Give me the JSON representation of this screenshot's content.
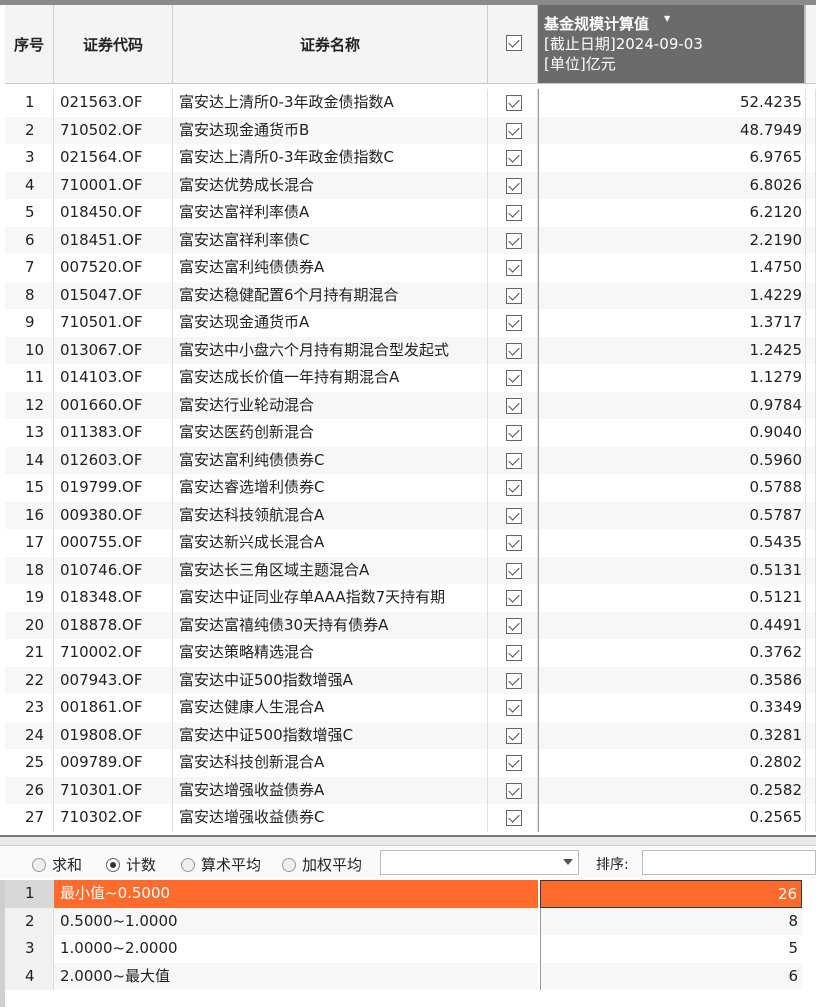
{
  "header": {
    "col_no": "序号",
    "col_code": "证券代码",
    "col_name": "证券名称",
    "metric_title": "基金规模计算值",
    "metric_date": "[截止日期]2024-09-03",
    "metric_unit": "[单位]亿元"
  },
  "rows": [
    {
      "no": "1",
      "code": "021563.OF",
      "name": "富安达上清所0-3年政金债指数A",
      "value": "52.4235"
    },
    {
      "no": "2",
      "code": "710502.OF",
      "name": "富安达现金通货币B",
      "value": "48.7949"
    },
    {
      "no": "3",
      "code": "021564.OF",
      "name": "富安达上清所0-3年政金债指数C",
      "value": "6.9765"
    },
    {
      "no": "4",
      "code": "710001.OF",
      "name": "富安达优势成长混合",
      "value": "6.8026"
    },
    {
      "no": "5",
      "code": "018450.OF",
      "name": "富安达富祥利率债A",
      "value": "6.2120"
    },
    {
      "no": "6",
      "code": "018451.OF",
      "name": "富安达富祥利率债C",
      "value": "2.2190"
    },
    {
      "no": "7",
      "code": "007520.OF",
      "name": "富安达富利纯债债券A",
      "value": "1.4750"
    },
    {
      "no": "8",
      "code": "015047.OF",
      "name": "富安达稳健配置6个月持有期混合",
      "value": "1.4229"
    },
    {
      "no": "9",
      "code": "710501.OF",
      "name": "富安达现金通货币A",
      "value": "1.3717"
    },
    {
      "no": "10",
      "code": "013067.OF",
      "name": "富安达中小盘六个月持有期混合型发起式",
      "value": "1.2425"
    },
    {
      "no": "11",
      "code": "014103.OF",
      "name": "富安达成长价值一年持有期混合A",
      "value": "1.1279"
    },
    {
      "no": "12",
      "code": "001660.OF",
      "name": "富安达行业轮动混合",
      "value": "0.9784"
    },
    {
      "no": "13",
      "code": "011383.OF",
      "name": "富安达医药创新混合",
      "value": "0.9040"
    },
    {
      "no": "14",
      "code": "012603.OF",
      "name": "富安达富利纯债债券C",
      "value": "0.5960"
    },
    {
      "no": "15",
      "code": "019799.OF",
      "name": "富安达睿选增利债券C",
      "value": "0.5788"
    },
    {
      "no": "16",
      "code": "009380.OF",
      "name": "富安达科技领航混合A",
      "value": "0.5787"
    },
    {
      "no": "17",
      "code": "000755.OF",
      "name": "富安达新兴成长混合A",
      "value": "0.5435"
    },
    {
      "no": "18",
      "code": "010746.OF",
      "name": "富安达长三角区域主题混合A",
      "value": "0.5131"
    },
    {
      "no": "19",
      "code": "018348.OF",
      "name": "富安达中证同业存单AAA指数7天持有期",
      "value": "0.5121"
    },
    {
      "no": "20",
      "code": "018878.OF",
      "name": "富安达富禧纯债30天持有债券A",
      "value": "0.4491"
    },
    {
      "no": "21",
      "code": "710002.OF",
      "name": "富安达策略精选混合",
      "value": "0.3762"
    },
    {
      "no": "22",
      "code": "007943.OF",
      "name": "富安达中证500指数增强A",
      "value": "0.3586"
    },
    {
      "no": "23",
      "code": "001861.OF",
      "name": "富安达健康人生混合A",
      "value": "0.3349"
    },
    {
      "no": "24",
      "code": "019808.OF",
      "name": "富安达中证500指数增强C",
      "value": "0.3281"
    },
    {
      "no": "25",
      "code": "009789.OF",
      "name": "富安达科技创新混合A",
      "value": "0.2802"
    },
    {
      "no": "26",
      "code": "710301.OF",
      "name": "富安达增强收益债券A",
      "value": "0.2582"
    },
    {
      "no": "27",
      "code": "710302.OF",
      "name": "富安达增强收益债券C",
      "value": "0.2565"
    }
  ],
  "toolbar": {
    "opt_sum": "求和",
    "opt_count": "计数",
    "opt_mean": "算术平均",
    "opt_weighted": "加权平均",
    "selected": "count",
    "dropdown_value": "",
    "sort_label": "排序:",
    "sort_value": ""
  },
  "stats": [
    {
      "no": "1",
      "range": "最小值~0.5000",
      "count": "26"
    },
    {
      "no": "2",
      "range": "0.5000~1.0000",
      "count": "8"
    },
    {
      "no": "3",
      "range": "1.0000~2.0000",
      "count": "5"
    },
    {
      "no": "4",
      "range": "2.0000~最大值",
      "count": "6"
    }
  ],
  "colors": {
    "selection": "#ff6b2c",
    "header_dark": "#6b6b6b"
  }
}
